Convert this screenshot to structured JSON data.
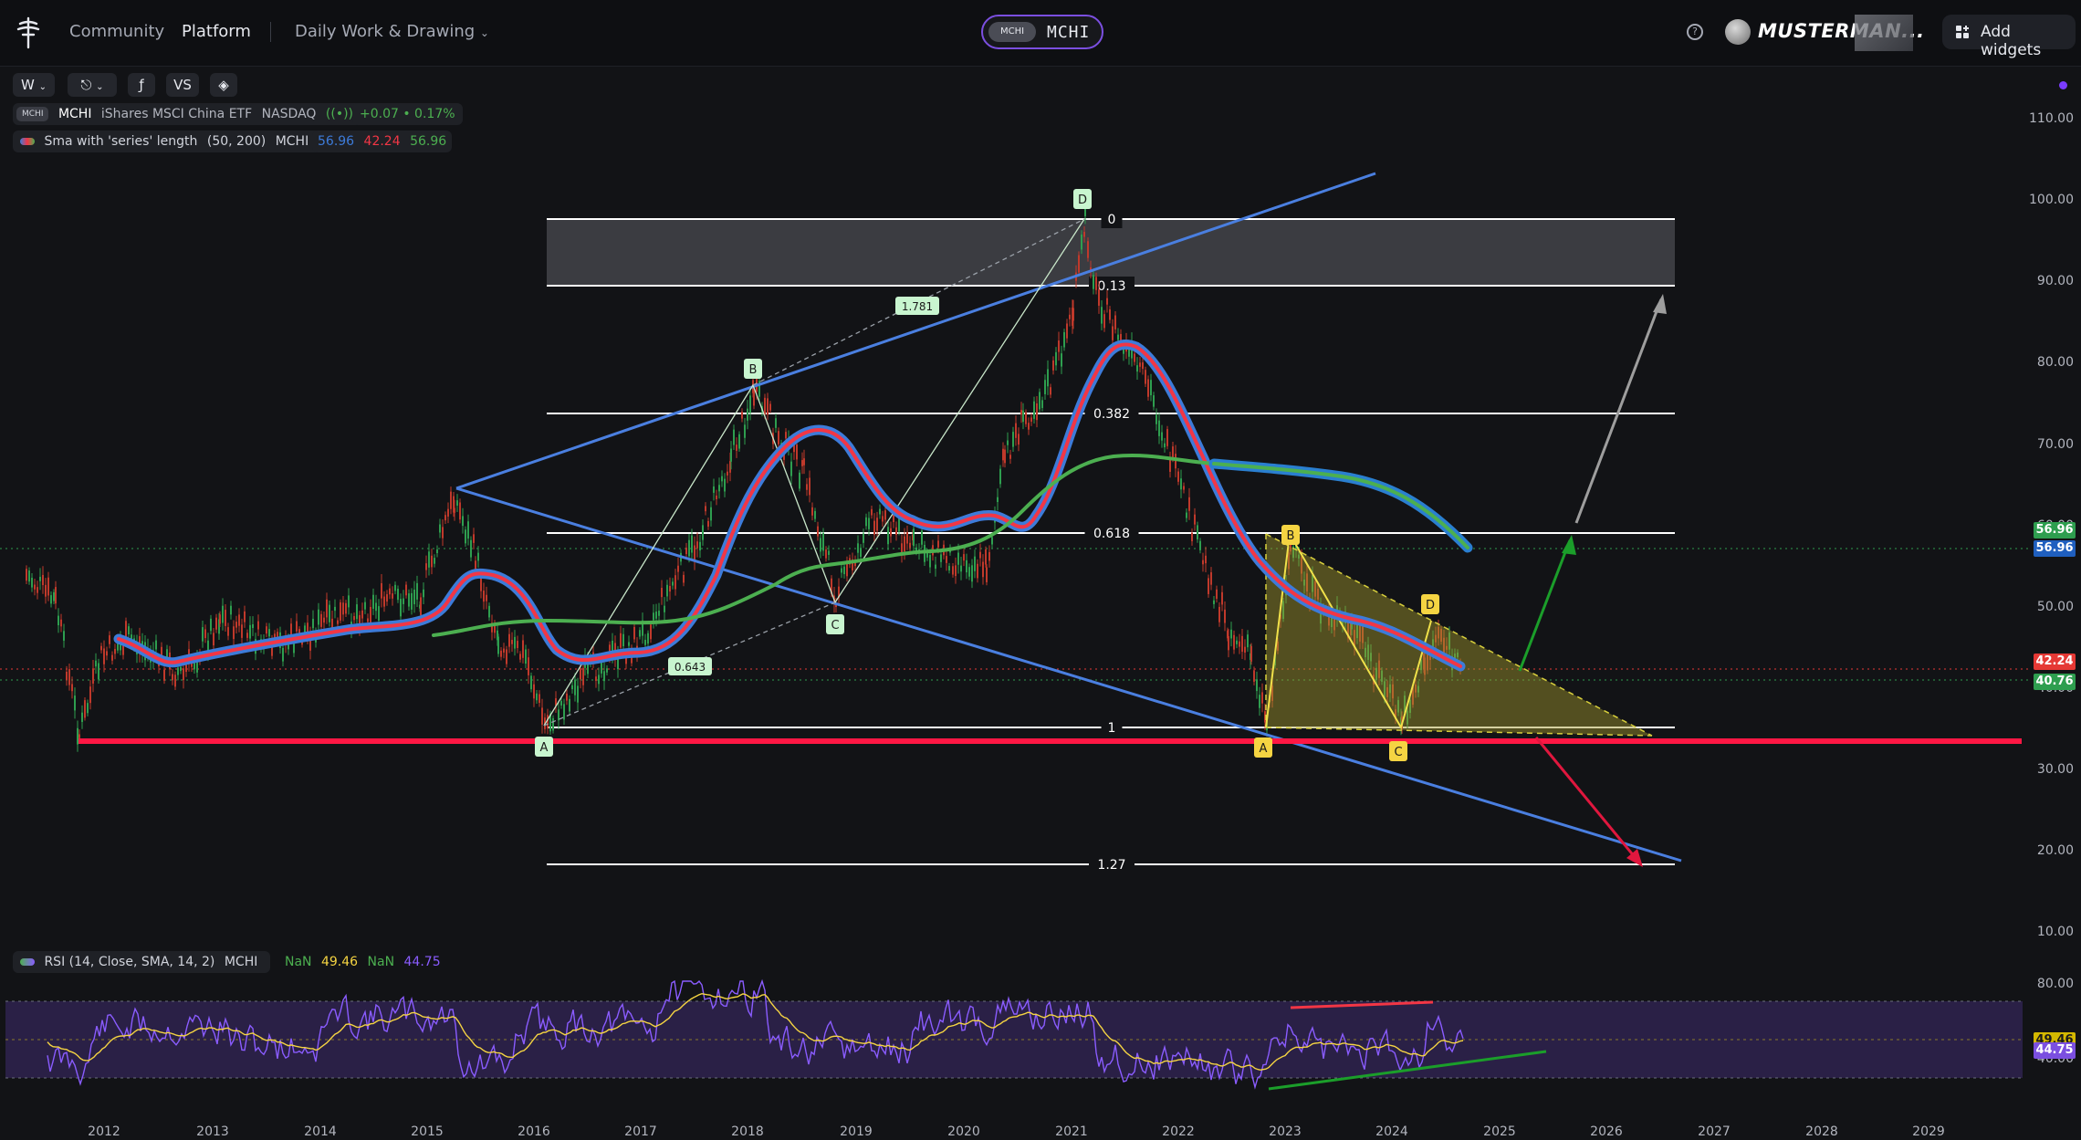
{
  "nav": {
    "community": "Community",
    "platform": "Platform",
    "workspace": "Daily Work & Drawing",
    "ticker_tag": "MCHI",
    "ticker": "MCHI",
    "help": "?",
    "username": "MUSTERMAN...",
    "add_widgets": "Add widgets"
  },
  "toolbar": {
    "interval": "W",
    "compare": "VS"
  },
  "legend": {
    "symbol_chip": "MCHI",
    "symbol": "MCHI",
    "name": "iShares MSCI China ETF",
    "exchange": "NASDAQ",
    "change": "+0.07 • 0.17%",
    "sma_label": "Sma with 'series' length",
    "sma_params": "(50, 200)",
    "sma_symbol": "MCHI",
    "sma_v1": "56.96",
    "sma_v2": "42.24",
    "sma_v3": "56.96",
    "rsi_label": "RSI (14, Close, SMA, 14, 2)",
    "rsi_symbol": "MCHI",
    "rsi_v1": "NaN",
    "rsi_v2": "49.46",
    "rsi_v3": "NaN",
    "rsi_v4": "44.75"
  },
  "colors": {
    "accent": "#7b4fe0",
    "sma_blue": "#3d7bd9",
    "sma_red": "#f23645",
    "sma_green": "#4caf50",
    "support_red": "#ff1744",
    "channel_blue": "#4a7fe0",
    "rsi_line": "#8a5cff",
    "rsi_signal": "#f5d442"
  },
  "price_axis": [
    "110.00",
    "100.00",
    "90.00",
    "80.00",
    "70.00",
    "60.00",
    "50.00",
    "40.00",
    "30.00",
    "20.00",
    "10.00"
  ],
  "price_tags": [
    {
      "value": "56.96",
      "color": "#2e9e4f"
    },
    {
      "value": "56.96",
      "color": "#1f5fbf"
    },
    {
      "value": "42.24",
      "color": "#e53935"
    },
    {
      "value": "40.76",
      "color": "#2e9e4f"
    }
  ],
  "rsi_axis": [
    "80.00",
    "40.00"
  ],
  "rsi_tags": [
    {
      "value": "49.46",
      "color": "#d4b800"
    },
    {
      "value": "44.75",
      "color": "#7b4fe0"
    }
  ],
  "time_axis": [
    "2012",
    "2013",
    "2014",
    "2015",
    "2016",
    "2017",
    "2018",
    "2019",
    "2020",
    "2021",
    "2022",
    "2023",
    "2024",
    "2025",
    "2026",
    "2027",
    "2028",
    "2029"
  ],
  "fib_levels": [
    "0",
    "0.13",
    "0.382",
    "0.618",
    "1",
    "1.27"
  ],
  "pattern_labels": {
    "abcd1": [
      "A",
      "B",
      "C",
      "D"
    ],
    "abcd2": [
      "A",
      "B",
      "C",
      "D"
    ],
    "ratios": [
      "1.781",
      "0.643"
    ]
  }
}
